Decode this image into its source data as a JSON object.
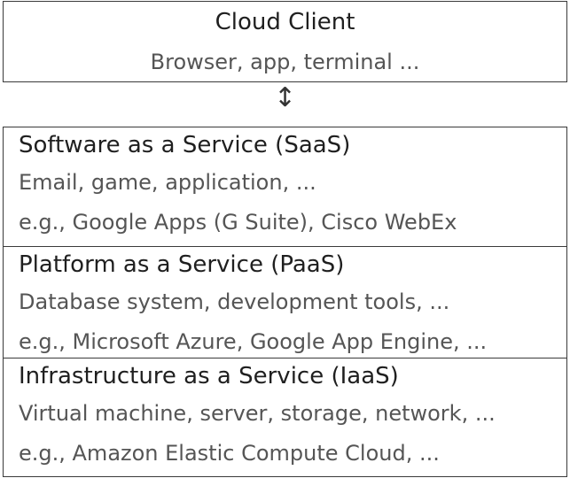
{
  "client": {
    "title": "Cloud Client",
    "subtitle": "Browser, app, terminal ..."
  },
  "arrow": "↕",
  "layers": [
    {
      "title": "Software as a Service (SaaS)",
      "line1": "Email, game, application, ...",
      "line2": "e.g., Google Apps (G Suite), Cisco WebEx"
    },
    {
      "title": "Platform as a Service (PaaS)",
      "line1": "Database system, development tools, ...",
      "line2": "e.g., Microsoft Azure, Google App Engine, ..."
    },
    {
      "title": "Infrastructure as a Service (IaaS)",
      "line1": "Virtual machine, server, storage, network, ...",
      "line2": "e.g., Amazon Elastic Compute Cloud, ..."
    }
  ]
}
